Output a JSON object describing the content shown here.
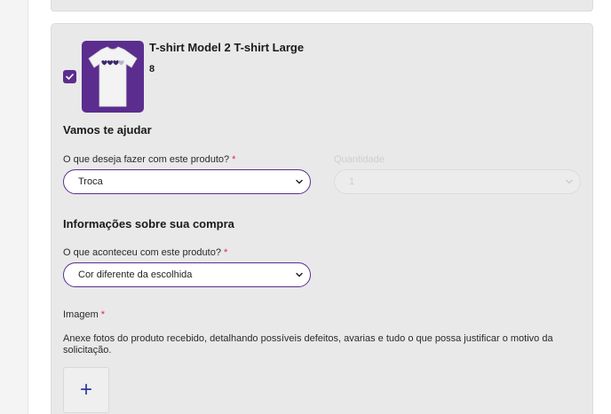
{
  "product": {
    "name": "T-shirt Model 2 T-shirt Large",
    "quantity": "8",
    "selected": true
  },
  "help_section": {
    "title": "Vamos te ajudar",
    "action_label": "O que deseja fazer com este produto?",
    "action_value": "Troca",
    "quantity_label": "Quantidade",
    "quantity_value": "1"
  },
  "purchase_section": {
    "title": "Informações sobre sua compra",
    "reason_label": "O que aconteceu com este produto?",
    "reason_value": "Cor diferente da escolhida"
  },
  "image_section": {
    "label": "Imagem",
    "instructions": "Anexe fotos do produto recebido, detalhando possíveis defeitos, avarias e tudo o que possa justificar o motivo da solicitação.",
    "add_symbol": "+"
  },
  "required_marker": "*",
  "colors": {
    "accent": "#5b2d8f",
    "required": "#e0245e",
    "add_icon": "#2f3a9c"
  }
}
